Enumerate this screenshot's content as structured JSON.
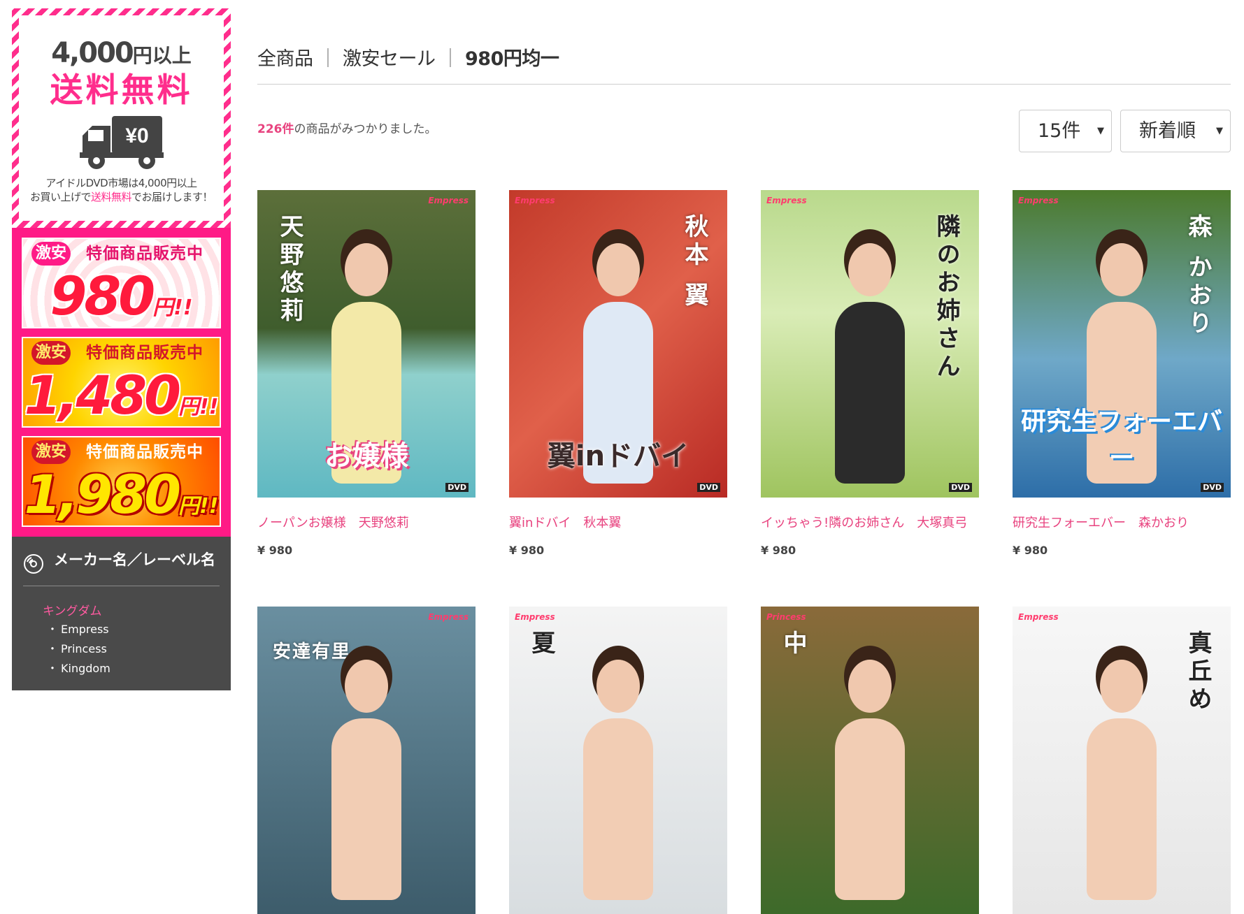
{
  "sidebar": {
    "shipping": {
      "amount": "4,000",
      "amount_suffix": "円以上",
      "free_label": "送料無料",
      "truck_price": "¥0",
      "note_line1": "アイドルDVD市場は4,000円以上",
      "note_line2_pre": "お買い上げで",
      "note_line2_highlight": "送料無料",
      "note_line2_post": "でお届けします！"
    },
    "promos": [
      {
        "tag": "激安",
        "heading": "特価商品販売中",
        "price": "980",
        "suffix": "円!!"
      },
      {
        "tag": "激安",
        "heading": "特価商品販売中",
        "price": "1,480",
        "suffix": "円!!"
      },
      {
        "tag": "激安",
        "heading": "特価商品販売中",
        "price": "1,980",
        "suffix": "円!!"
      }
    ],
    "maker": {
      "title": "メーカー名／レーベル名",
      "icon": "disc-icon",
      "parent": "キングダム",
      "children": [
        "Empress",
        "Princess",
        "Kingdom"
      ]
    }
  },
  "main": {
    "breadcrumb": [
      "全商品",
      "激安セール",
      "980円均一"
    ],
    "result_count": "226",
    "result_count_unit": "件",
    "result_text": "の商品がみつかりました。",
    "per_page": {
      "selected": "15件"
    },
    "sort": {
      "selected": "新着順"
    },
    "products": [
      {
        "name": "ノーパンお嬢様　天野悠莉",
        "price": "¥ 980",
        "brand": "Empress",
        "cover_vertical": "天野悠莉",
        "cover_title": "お嬢様"
      },
      {
        "name": "翼inドバイ　秋本翼",
        "price": "¥ 980",
        "brand": "Empress",
        "cover_vertical": "秋本 翼",
        "cover_title": "翼inドバイ"
      },
      {
        "name": "イッちゃう!隣のお姉さん　大塚真弓",
        "price": "¥ 980",
        "brand": "Empress",
        "cover_vertical": "隣のお姉さん",
        "cover_title": ""
      },
      {
        "name": "研究生フォーエバー　森かおり",
        "price": "¥ 980",
        "brand": "Empress",
        "cover_vertical": "森 かおり",
        "cover_title": "研究生フォーエバー"
      },
      {
        "name": "",
        "price": "",
        "brand": "Empress",
        "cover_vertical": "安達有里",
        "cover_title": ""
      },
      {
        "name": "",
        "price": "",
        "brand": "Empress",
        "cover_vertical": "夏",
        "cover_title": ""
      },
      {
        "name": "",
        "price": "",
        "brand": "Princess",
        "cover_vertical": "中",
        "cover_title": ""
      },
      {
        "name": "",
        "price": "",
        "brand": "Empress",
        "cover_vertical": "真丘め",
        "cover_title": ""
      }
    ]
  },
  "colors": {
    "accent_pink": "#e8437f",
    "sidebar_pink": "#ff1a86",
    "sidebar_dark": "#4a4a4a"
  }
}
